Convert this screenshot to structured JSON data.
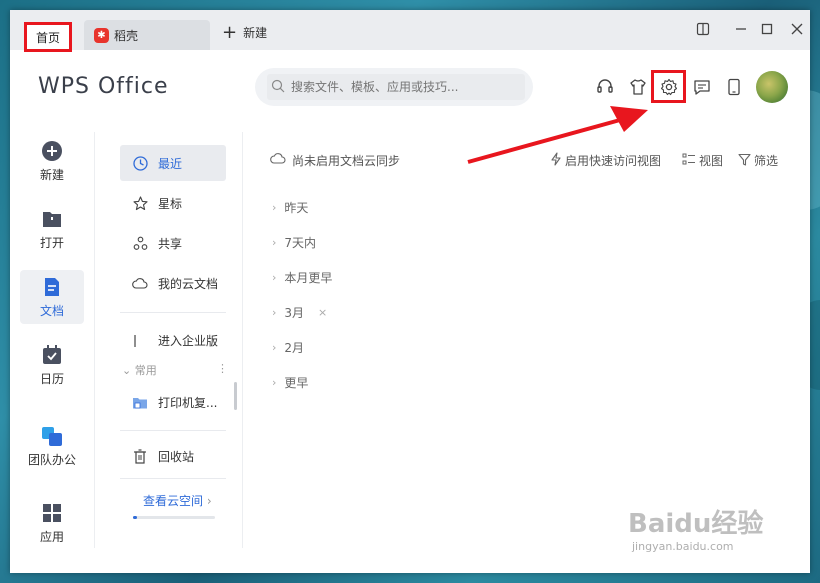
{
  "tabs": {
    "home": "首页",
    "docer": "稻壳",
    "new_tab": "新建"
  },
  "header": {
    "logo": "WPS Office",
    "search_placeholder": "搜索文件、模板、应用或技巧..."
  },
  "rail": [
    {
      "label": "新建",
      "icon": "plus-circle-icon"
    },
    {
      "label": "打开",
      "icon": "folder-icon"
    },
    {
      "label": "文档",
      "icon": "document-icon",
      "active": true
    },
    {
      "label": "日历",
      "icon": "calendar-icon"
    },
    {
      "label": "团队办公",
      "icon": "team-icon"
    },
    {
      "label": "应用",
      "icon": "apps-grid-icon"
    }
  ],
  "nav": {
    "recent": "最近",
    "starred": "星标",
    "shared": "共享",
    "cloud_docs": "我的云文档",
    "enterprise": "进入企业版",
    "common_section": "常用",
    "printer": "打印机复...",
    "recycle": "回收站",
    "view_cloud": "查看云空间",
    "cloud_usage_fraction": 0.03
  },
  "main": {
    "cloud_sync": "尚未启用文档云同步",
    "quick_access": "启用快速访问视图",
    "view": "视图",
    "filter": "筛选",
    "groups": [
      "昨天",
      "7天内",
      "本月更早",
      "3月",
      "2月",
      "更早"
    ]
  },
  "watermark": {
    "brand": "Baidu经验",
    "url": "jingyan.baidu.com"
  },
  "colors": {
    "highlight_red": "#e8161e",
    "accent_blue": "#2f6bd8"
  }
}
